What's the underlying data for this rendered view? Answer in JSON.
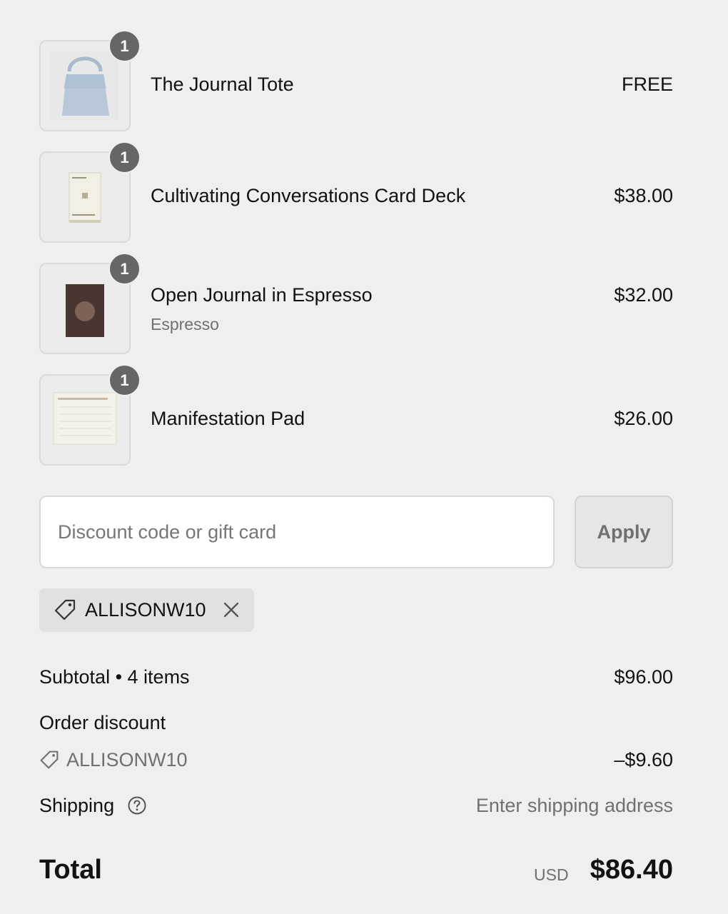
{
  "line_items": [
    {
      "quantity": "1",
      "name": "The Journal Tote",
      "variant": "",
      "price": "FREE",
      "image_icon": "tote-bag-image"
    },
    {
      "quantity": "1",
      "name": "Cultivating Conversations Card Deck",
      "variant": "",
      "price": "$38.00",
      "image_icon": "card-deck-image"
    },
    {
      "quantity": "1",
      "name": "Open Journal in Espresso",
      "variant": "Espresso",
      "price": "$32.00",
      "image_icon": "journal-image"
    },
    {
      "quantity": "1",
      "name": "Manifestation Pad",
      "variant": "",
      "price": "$26.00",
      "image_icon": "notepad-image"
    }
  ],
  "discount": {
    "placeholder": "Discount code or gift card",
    "value": "",
    "apply_label": "Apply",
    "applied_code": "ALLISONW10"
  },
  "summary": {
    "subtotal_label": "Subtotal • 4 items",
    "subtotal_value": "$96.00",
    "order_discount_label": "Order discount",
    "discount_code": "ALLISONW10",
    "discount_value": "–$9.60",
    "shipping_label": "Shipping",
    "shipping_value": "Enter shipping address",
    "total_label": "Total",
    "currency": "USD",
    "total_value": "$86.40"
  },
  "colors": {
    "page_background": "#efefef",
    "badge": "#666666",
    "muted_text": "#707070"
  }
}
